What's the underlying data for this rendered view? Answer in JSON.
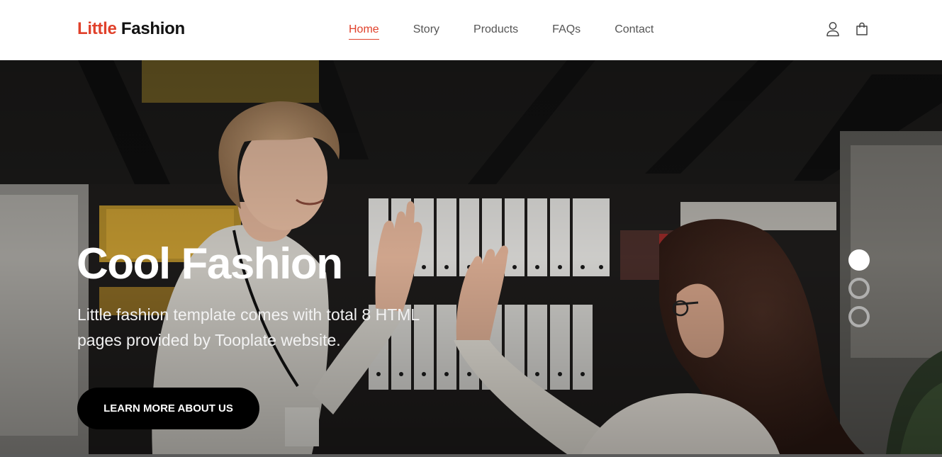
{
  "brand": {
    "first": "Little",
    "second": "Fashion",
    "accent_color": "#e0412b"
  },
  "nav": {
    "items": [
      {
        "label": "Home",
        "active": true
      },
      {
        "label": "Story",
        "active": false
      },
      {
        "label": "Products",
        "active": false
      },
      {
        "label": "FAQs",
        "active": false
      },
      {
        "label": "Contact",
        "active": false
      }
    ],
    "icons": [
      "user-icon",
      "shopping-bag-icon"
    ]
  },
  "hero": {
    "title": "Cool Fashion",
    "subtitle": "Little fashion template comes with total 8 HTML pages provided by Tooplate website.",
    "cta_label": "LEARN MORE ABOUT US",
    "slides": {
      "count": 3,
      "active_index": 0
    }
  }
}
